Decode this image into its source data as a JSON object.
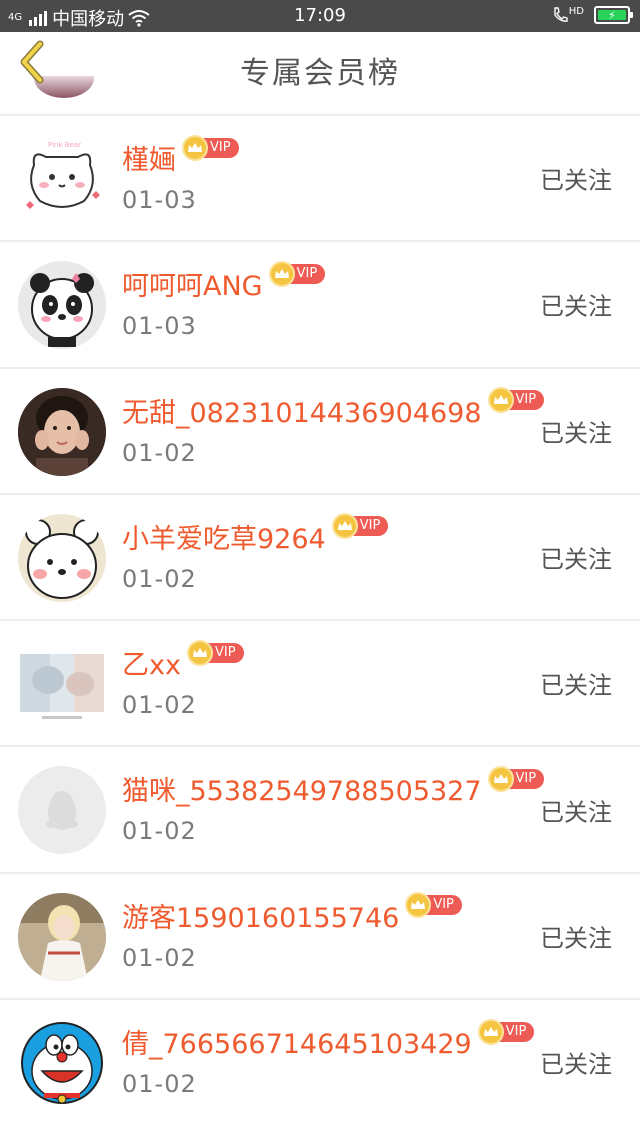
{
  "status_bar": {
    "network": "4G",
    "carrier": "中国移动",
    "time": "17:09",
    "hd": "HD"
  },
  "header": {
    "title": "专属会员榜",
    "back_icon": "chevron-left-icon"
  },
  "vip_label": "VIP",
  "colors": {
    "name": "#ef5b2f",
    "vip_tag": "#ee5b54",
    "crown": "#f5c542",
    "status_bar": "#4a4a4a",
    "battery": "#29d35a"
  },
  "members": [
    {
      "name": "槿婳",
      "date": "01-03",
      "action": "已关注",
      "avatar": "cat-sticker"
    },
    {
      "name": "呵呵呵ANG",
      "date": "01-03",
      "action": "已关注",
      "avatar": "panda-sticker"
    },
    {
      "name": "无甜_08231014436904698",
      "date": "01-02",
      "action": "已关注",
      "avatar": "girl-photo"
    },
    {
      "name": "小羊爱吃草9264",
      "date": "01-02",
      "action": "已关注",
      "avatar": "bear-sticker"
    },
    {
      "name": "乙xx",
      "date": "01-02",
      "action": "已关注",
      "avatar": "blurred-photo"
    },
    {
      "name": "猫咪_55382549788505327",
      "date": "01-02",
      "action": "已关注",
      "avatar": "default-penguin"
    },
    {
      "name": "游客1590160155746",
      "date": "01-02",
      "action": "已关注",
      "avatar": "anime-girl"
    },
    {
      "name": "倩_766566714645103429",
      "date": "01-02",
      "action": "已关注",
      "avatar": "doraemon"
    }
  ]
}
